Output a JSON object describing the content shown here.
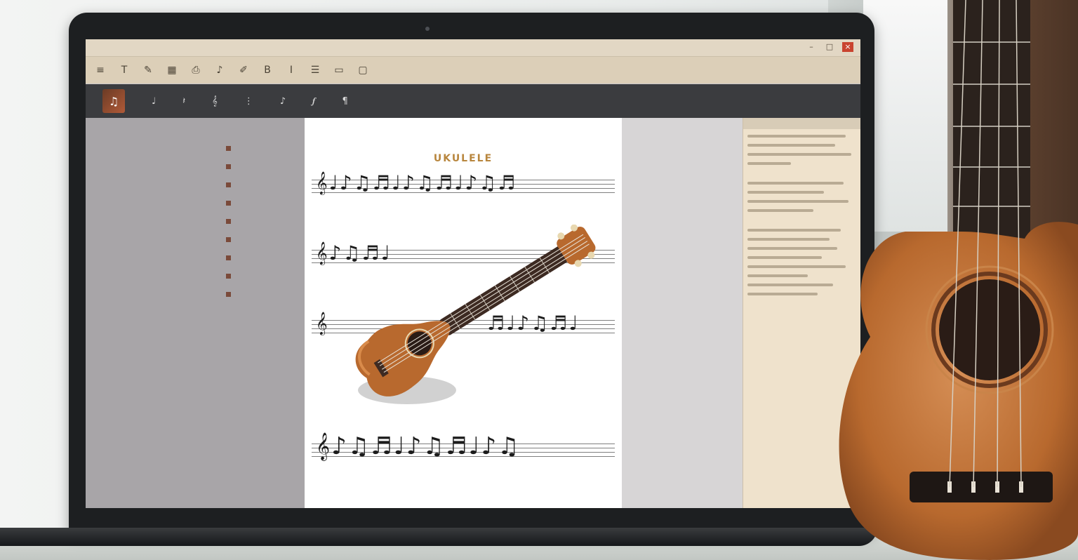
{
  "scene": {
    "description_tags": [
      "laptop",
      "music-notation-software",
      "ukulele"
    ]
  },
  "window": {
    "title": "",
    "controls": {
      "minimize": "–",
      "maximize": "□",
      "close": "×"
    }
  },
  "toolbar_top": {
    "icons": [
      "menu-icon",
      "text-icon",
      "pen-icon",
      "table-icon",
      "print-icon",
      "music-note-icon",
      "pencil-icon",
      "bold-icon",
      "italic-icon",
      "align-icon",
      "layout-icon",
      "frame-icon"
    ]
  },
  "toolbar_dark": {
    "tools": [
      "",
      "",
      "",
      "",
      "",
      ""
    ]
  },
  "left_panel": {
    "outline_count": 9
  },
  "page": {
    "heading_1": "UKULELE",
    "caption": ""
  },
  "colors": {
    "accent_gold": "#b8863e",
    "uke_body": "#b8692e",
    "uke_body_light": "#d98b4a",
    "fretboard": "#3d2a22",
    "screen_toolbar_light": "#dccfb8",
    "screen_toolbar_dark": "#3b3c3f"
  }
}
